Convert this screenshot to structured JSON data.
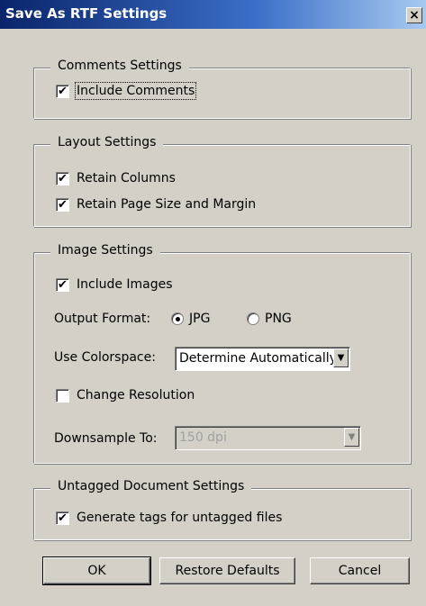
{
  "window": {
    "title": "Save As RTF Settings",
    "close_glyph": "×"
  },
  "comments": {
    "legend": "Comments Settings",
    "include_comments": {
      "label": "Include Comments",
      "checked": true
    }
  },
  "layout": {
    "legend": "Layout Settings",
    "retain_columns": {
      "label": "Retain Columns",
      "checked": true
    },
    "retain_page_size": {
      "label": "Retain Page Size and Margin",
      "checked": true
    }
  },
  "image": {
    "legend": "Image Settings",
    "include_images": {
      "label": "Include Images",
      "checked": true
    },
    "output_format_label": "Output Format:",
    "format_options": [
      {
        "label": "JPG",
        "selected": true
      },
      {
        "label": "PNG",
        "selected": false
      }
    ],
    "colorspace_label": "Use Colorspace:",
    "colorspace_value": "Determine Automatically",
    "change_resolution": {
      "label": "Change Resolution",
      "checked": false
    },
    "downsample_label": "Downsample To:",
    "downsample_value": "150 dpi"
  },
  "untagged": {
    "legend": "Untagged Document Settings",
    "generate_tags": {
      "label": "Generate tags for untagged files",
      "checked": true
    }
  },
  "buttons": {
    "ok": "OK",
    "restore": "Restore Defaults",
    "cancel": "Cancel"
  },
  "icons": {
    "check": "check-icon",
    "dropdown": "chevron-down-icon",
    "close": "close-icon"
  },
  "colors": {
    "title_start": "#0a246a",
    "title_end": "#a6caf0",
    "face": "#d4d0c8"
  }
}
